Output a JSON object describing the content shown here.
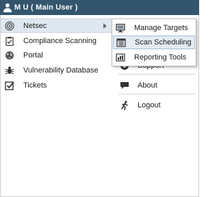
{
  "header": {
    "user_label": "M U ( Main User )"
  },
  "left_menu": {
    "items": [
      {
        "label": "Netsec",
        "icon": "radar-icon"
      },
      {
        "label": "Compliance Scanning",
        "icon": "clipboard-check-icon"
      },
      {
        "label": "Portal",
        "icon": "globe-icon"
      },
      {
        "label": "Vulnerability Database",
        "icon": "bug-icon"
      },
      {
        "label": "Tickets",
        "icon": "checkbox-icon"
      }
    ]
  },
  "submenu": {
    "items": [
      {
        "label": "Manage Targets",
        "icon": "monitor-icon"
      },
      {
        "label": "Scan Scheduling",
        "icon": "calendar-icon"
      },
      {
        "label": "Reporting Tools",
        "icon": "report-icon"
      }
    ]
  },
  "right_menu": {
    "items": [
      {
        "label": "Support",
        "icon": "lifebuoy-icon"
      },
      {
        "label": "About",
        "icon": "speech-bubble-icon"
      },
      {
        "label": "Logout",
        "icon": "running-man-icon"
      }
    ]
  }
}
